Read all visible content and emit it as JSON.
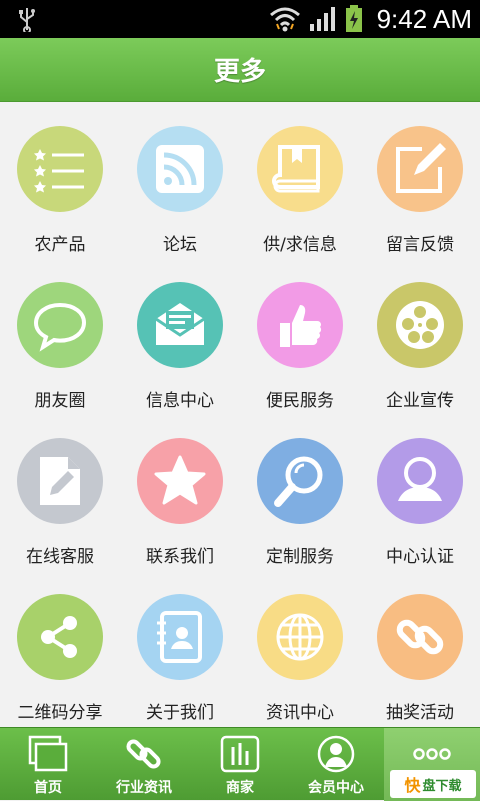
{
  "status_bar": {
    "time": "9:42 AM"
  },
  "header": {
    "title": "更多"
  },
  "grid": {
    "items": [
      {
        "label": "农产品",
        "icon": "list-stars-icon",
        "color": "#c8d87a"
      },
      {
        "label": "论坛",
        "icon": "rss-icon",
        "color": "#b5def2"
      },
      {
        "label": "供/求信息",
        "icon": "book-icon",
        "color": "#f8dd8c"
      },
      {
        "label": "留言反馈",
        "icon": "edit-note-icon",
        "color": "#f8c38a"
      },
      {
        "label": "朋友圈",
        "icon": "speech-bubble-icon",
        "color": "#9ed67c"
      },
      {
        "label": "信息中心",
        "icon": "mail-icon",
        "color": "#56c2b5"
      },
      {
        "label": "便民服务",
        "icon": "thumbs-up-icon",
        "color": "#f29be6"
      },
      {
        "label": "企业宣传",
        "icon": "film-reel-icon",
        "color": "#c9c769"
      },
      {
        "label": "在线客服",
        "icon": "document-pen-icon",
        "color": "#c4c8cf"
      },
      {
        "label": "联系我们",
        "icon": "star-icon",
        "color": "#f7a1a8"
      },
      {
        "label": "定制服务",
        "icon": "magnifier-icon",
        "color": "#7faee2"
      },
      {
        "label": "中心认证",
        "icon": "user-icon",
        "color": "#b39be8"
      },
      {
        "label": "二维码分享",
        "icon": "share-icon",
        "color": "#a8d16a"
      },
      {
        "label": "关于我们",
        "icon": "contact-book-icon",
        "color": "#a5d4f2"
      },
      {
        "label": "资讯中心",
        "icon": "globe-icon",
        "color": "#f8dc86"
      },
      {
        "label": "抽奖活动",
        "icon": "chain-link-icon",
        "color": "#f8bd82"
      }
    ]
  },
  "bottom_nav": {
    "items": [
      {
        "label": "首页",
        "icon": "home-window-icon"
      },
      {
        "label": "行业资讯",
        "icon": "chain-link-icon"
      },
      {
        "label": "商家",
        "icon": "bar-chart-icon"
      },
      {
        "label": "会员中心",
        "icon": "person-icon"
      },
      {
        "label": "",
        "icon": "more-dots-icon"
      }
    ]
  },
  "watermark": {
    "prefix": "快",
    "text": "盘下载"
  },
  "colors": {
    "header_green": "#6cbf4a",
    "nav_green": "#5aad3b"
  }
}
